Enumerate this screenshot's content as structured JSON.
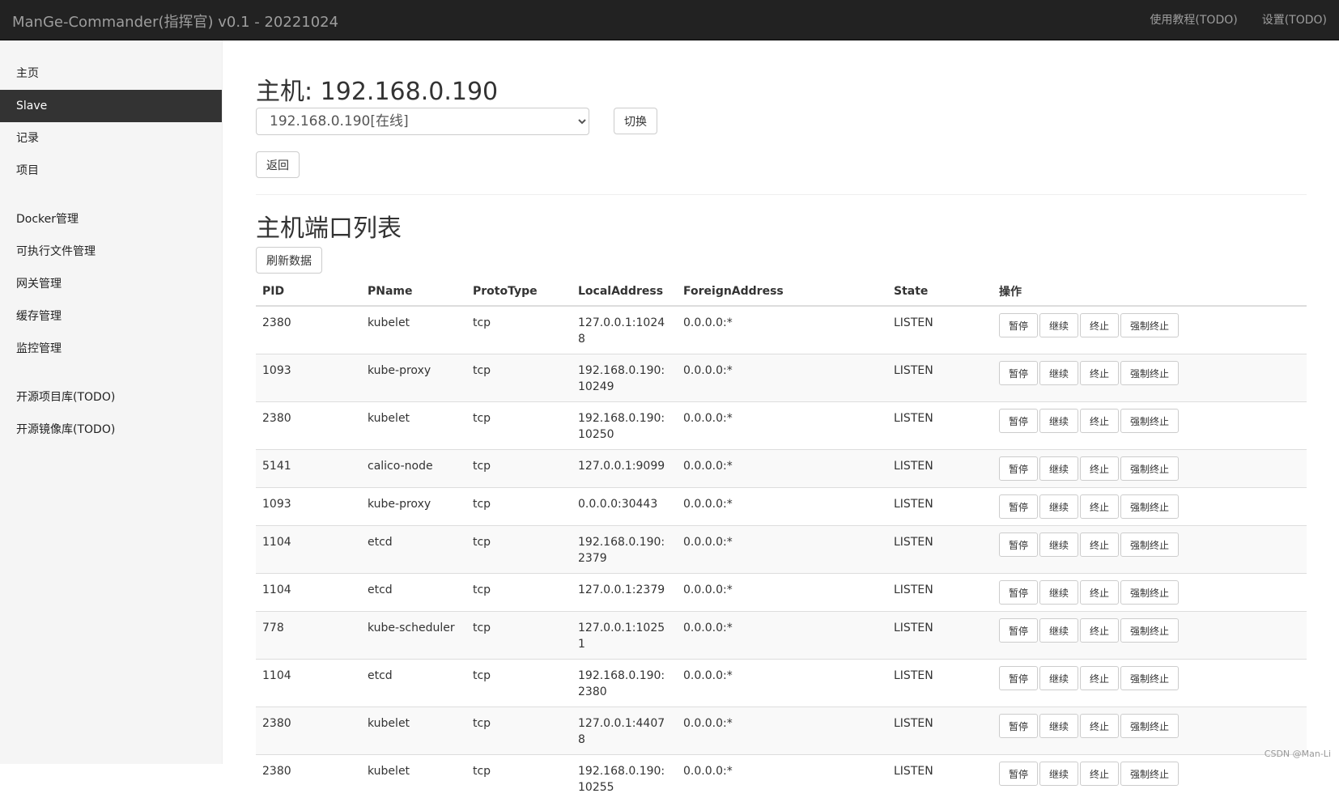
{
  "app": {
    "title": "ManGe-Commander(指挥官) v0.1 - 20221024",
    "nav": [
      "使用教程(TODO)",
      "设置(TODO)"
    ]
  },
  "sidebar": {
    "groups": [
      [
        {
          "label": "主页"
        },
        {
          "label": "Slave",
          "active": true
        },
        {
          "label": "记录"
        },
        {
          "label": "项目"
        }
      ],
      [
        {
          "label": "Docker管理"
        },
        {
          "label": "可执行文件管理"
        },
        {
          "label": "网关管理"
        },
        {
          "label": "缓存管理"
        },
        {
          "label": "监控管理"
        }
      ],
      [
        {
          "label": "开源项目库(TODO)"
        },
        {
          "label": "开源镜像库(TODO)"
        }
      ]
    ]
  },
  "main": {
    "title": "主机: 192.168.0.190",
    "host_select": {
      "selected": "192.168.0.190[在线]"
    },
    "switch_label": "切换",
    "back_label": "返回",
    "section_title": "主机端口列表",
    "refresh_label": "刷新数据"
  },
  "table": {
    "headers": [
      "PID",
      "PName",
      "ProtoType",
      "LocalAddress",
      "ForeignAddress",
      "State",
      "操作"
    ],
    "actions": [
      "暂停",
      "继续",
      "终止",
      "强制终止"
    ],
    "rows": [
      {
        "pid": "2380",
        "pname": "kubelet",
        "proto": "tcp",
        "local": "127.0.0.1:10248",
        "foreign": "0.0.0.0:*",
        "state": "LISTEN"
      },
      {
        "pid": "1093",
        "pname": "kube-proxy",
        "proto": "tcp",
        "local": "192.168.0.190:10249",
        "foreign": "0.0.0.0:*",
        "state": "LISTEN"
      },
      {
        "pid": "2380",
        "pname": "kubelet",
        "proto": "tcp",
        "local": "192.168.0.190:10250",
        "foreign": "0.0.0.0:*",
        "state": "LISTEN"
      },
      {
        "pid": "5141",
        "pname": "calico-node",
        "proto": "tcp",
        "local": "127.0.0.1:9099",
        "foreign": "0.0.0.0:*",
        "state": "LISTEN"
      },
      {
        "pid": "1093",
        "pname": "kube-proxy",
        "proto": "tcp",
        "local": "0.0.0.0:30443",
        "foreign": "0.0.0.0:*",
        "state": "LISTEN"
      },
      {
        "pid": "1104",
        "pname": "etcd",
        "proto": "tcp",
        "local": "192.168.0.190:2379",
        "foreign": "0.0.0.0:*",
        "state": "LISTEN"
      },
      {
        "pid": "1104",
        "pname": "etcd",
        "proto": "tcp",
        "local": "127.0.0.1:2379",
        "foreign": "0.0.0.0:*",
        "state": "LISTEN"
      },
      {
        "pid": "778",
        "pname": "kube-scheduler",
        "proto": "tcp",
        "local": "127.0.0.1:10251",
        "foreign": "0.0.0.0:*",
        "state": "LISTEN"
      },
      {
        "pid": "1104",
        "pname": "etcd",
        "proto": "tcp",
        "local": "192.168.0.190:2380",
        "foreign": "0.0.0.0:*",
        "state": "LISTEN"
      },
      {
        "pid": "2380",
        "pname": "kubelet",
        "proto": "tcp",
        "local": "127.0.0.1:44078",
        "foreign": "0.0.0.0:*",
        "state": "LISTEN"
      },
      {
        "pid": "2380",
        "pname": "kubelet",
        "proto": "tcp",
        "local": "192.168.0.190:10255",
        "foreign": "0.0.0.0:*",
        "state": "LISTEN"
      }
    ]
  },
  "watermark": "CSDN @Man-Li"
}
